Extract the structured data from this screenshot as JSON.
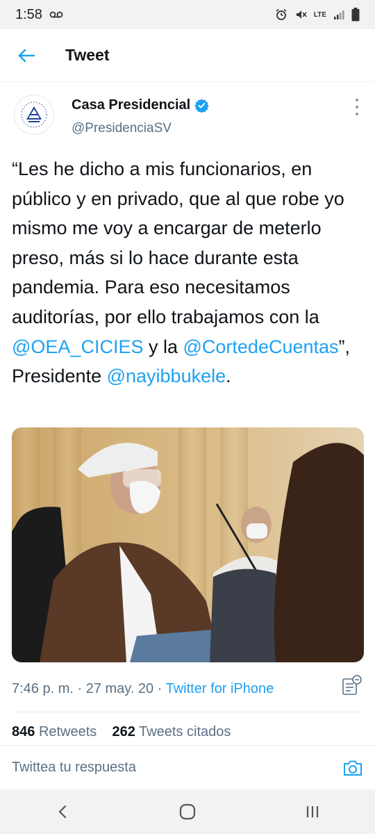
{
  "status_bar": {
    "time": "1:58",
    "network": "LTE"
  },
  "header": {
    "title": "Tweet"
  },
  "tweet": {
    "author_name": "Casa Presidencial",
    "author_handle": "@PresidenciaSV",
    "text_segments": [
      {
        "text": "“Les he dicho a mis funcionarios, en público y en privado, que al que robe yo mismo me voy a encargar de meterlo preso, más si lo hace durante esta pandemia. Para eso necesitamos auditorías, por ello trabajamos  con la ",
        "type": "text"
      },
      {
        "text": "@OEA_CICIES",
        "type": "mention"
      },
      {
        "text": " y la ",
        "type": "text"
      },
      {
        "text": "@CortedeCuentas",
        "type": "mention"
      },
      {
        "text": "”, Presidente ",
        "type": "text"
      },
      {
        "text": "@nayibbukele",
        "type": "mention"
      },
      {
        "text": ".",
        "type": "text"
      }
    ],
    "time": "7:46 p. m.",
    "date": "27 may. 20",
    "source": "Twitter for iPhone",
    "retweets_count": "846",
    "retweets_label": "Retweets",
    "quotes_count": "262",
    "quotes_label": "Tweets citados"
  },
  "reply": {
    "placeholder": "Twittea tu respuesta"
  },
  "icons": {
    "back": "arrow-left-icon",
    "verified": "verified-badge-icon",
    "more": "more-vertical-icon",
    "camera": "camera-icon",
    "analytics": "analytics-icon"
  },
  "colors": {
    "accent": "#1da1f2",
    "secondary_text": "#5b7083",
    "primary_text": "#0f1419"
  }
}
